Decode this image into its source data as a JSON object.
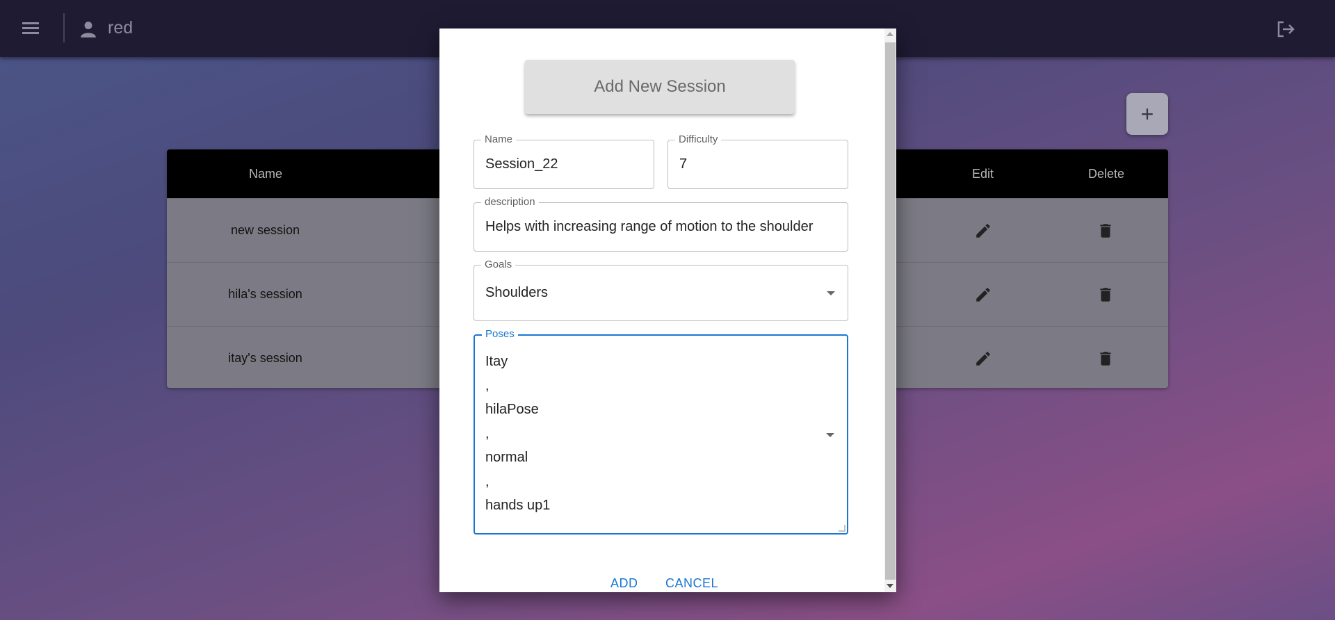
{
  "header": {
    "username": "red",
    "menu_icon": "menu-icon",
    "user_icon": "person-icon",
    "logout_icon": "logout-icon"
  },
  "add_button_label": "+",
  "table": {
    "columns": [
      "Name",
      "Edit",
      "Delete"
    ],
    "rows": [
      {
        "name": "new session"
      },
      {
        "name": "hila's session"
      },
      {
        "name": "itay's session"
      }
    ],
    "edit_icon": "pencil-icon",
    "delete_icon": "trash-icon"
  },
  "modal": {
    "title": "Add New Session",
    "name_label": "Name",
    "name_value": "Session_22",
    "difficulty_label": "Difficulty",
    "difficulty_value": "7",
    "description_label": "description",
    "description_value": "Helps with increasing range of motion to the shoulder",
    "goals_label": "Goals",
    "goals_value": "Shoulders",
    "poses_label": "Poses",
    "poses_lines": [
      "Itay",
      ",",
      "hilaPose",
      ",",
      "normal",
      ",",
      "hands up1"
    ],
    "add_label": "ADD",
    "cancel_label": "CANCEL"
  },
  "colors": {
    "accent": "#1976d2",
    "topbar": "#1e1b33",
    "table_header": "#000000"
  }
}
